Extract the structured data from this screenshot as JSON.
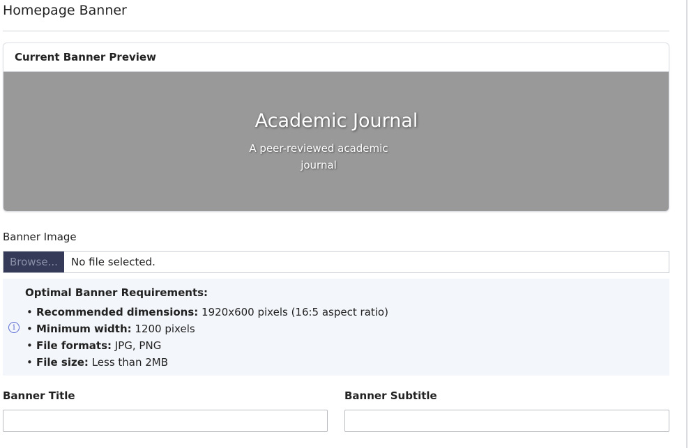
{
  "page": {
    "title": "Homepage Banner"
  },
  "preview": {
    "header": "Current Banner Preview",
    "banner_title": "Academic Journal",
    "banner_subtitle": "A peer-reviewed academic journal",
    "background_color": "#999999"
  },
  "banner_image": {
    "label": "Banner Image",
    "browse_label": "Browse...",
    "file_status": "No file selected."
  },
  "requirements": {
    "icon": "info-icon",
    "heading": "Optimal Banner Requirements:",
    "items": [
      {
        "term": "Recommended dimensions:",
        "value": "1920x600 pixels (16:5 aspect ratio)"
      },
      {
        "term": "Minimum width:",
        "value": "1200 pixels"
      },
      {
        "term": "File formats:",
        "value": "JPG, PNG"
      },
      {
        "term": "File size:",
        "value": "Less than 2MB"
      }
    ]
  },
  "fields": {
    "title_label": "Banner Title",
    "title_value": "",
    "subtitle_label": "Banner Subtitle",
    "subtitle_value": ""
  }
}
